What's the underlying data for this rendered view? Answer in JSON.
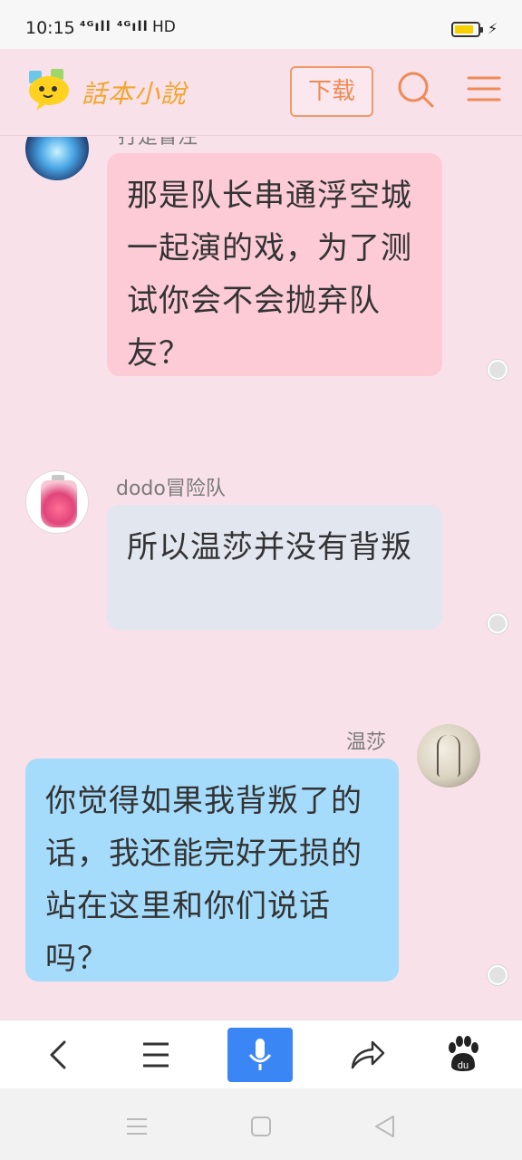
{
  "status_bar": {
    "time": "10:15",
    "signal": "⁴ᴳıll ⁴ᴳıll",
    "hd": "HD",
    "battery_level": 0.85,
    "battery_color": "#f7d000"
  },
  "header": {
    "logo_text": "話本小說",
    "download_label": "下载",
    "search_icon": "search-icon",
    "menu_icon": "hamburger-menu-icon"
  },
  "chat": {
    "messages": [
      {
        "sender": "打是冒注",
        "text": "那是队长串通浮空城一起演的戏，为了测试你会不会抛弃队友？",
        "side": "left",
        "bubble_color": "#fccbd6"
      },
      {
        "sender": "dodo冒险队",
        "text": "所以温莎并没有背叛",
        "side": "left",
        "bubble_color": "#e2e6ef"
      },
      {
        "sender": "温莎",
        "text": "你觉得如果我背叛了的话，我还能完好无损的站在这里和你们说话吗？",
        "side": "right",
        "bubble_color": "#a6dcfb"
      }
    ]
  },
  "toolbar": {
    "items": [
      "back-icon",
      "menu-icon",
      "microphone-icon",
      "share-icon",
      "baidu-paw-icon"
    ],
    "voice_color": "#3b86f5"
  },
  "nav_bar": {
    "items": [
      "recent-apps-icon",
      "home-icon",
      "back-triangle-icon"
    ]
  }
}
